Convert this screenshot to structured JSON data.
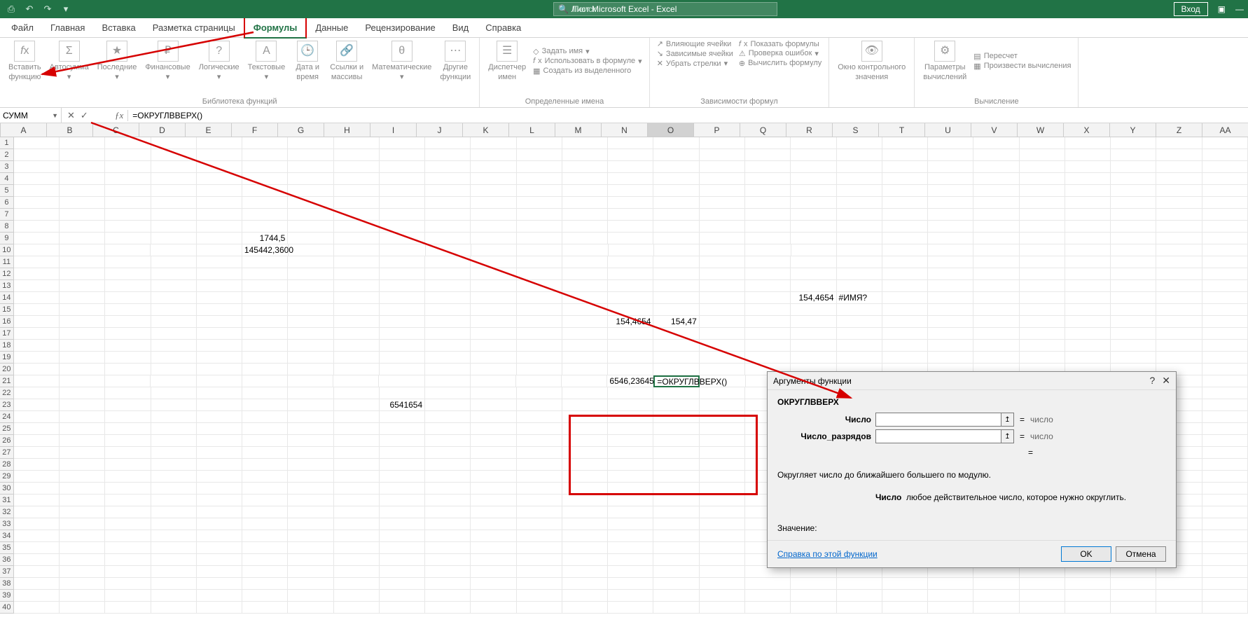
{
  "titlebar": {
    "title": "Лист Microsoft Excel  -  Excel",
    "search_placeholder": "Поиск",
    "login": "Вход"
  },
  "menu": {
    "items": [
      "Файл",
      "Главная",
      "Вставка",
      "Разметка страницы",
      "Формулы",
      "Данные",
      "Рецензирование",
      "Вид",
      "Справка"
    ],
    "active_index": 4
  },
  "ribbon": {
    "group1": {
      "insert_fn_l1": "Вставить",
      "insert_fn_l2": "функцию",
      "autosum_l1": "Автосумма",
      "recent_l1": "Последние",
      "financial_l1": "Финансовые",
      "logical_l1": "Логические",
      "text_l1": "Текстовые",
      "datetime_l1": "Дата и",
      "datetime_l2": "время",
      "lookup_l1": "Ссылки и",
      "lookup_l2": "массивы",
      "math_l1": "Математические",
      "other_l1": "Другие",
      "other_l2": "функции",
      "label": "Библиотека функций"
    },
    "group2": {
      "mgr_l1": "Диспетчер",
      "mgr_l2": "имен",
      "def_name": "Задать имя",
      "use_formula": "Использовать в формуле",
      "from_sel": "Создать из выделенного",
      "label": "Определенные имена"
    },
    "group3": {
      "trace_prec": "Влияющие ячейки",
      "trace_dep": "Зависимые ячейки",
      "remove_arr": "Убрать стрелки",
      "show_form": "Показать формулы",
      "check_err": "Проверка ошибок",
      "eval_form": "Вычислить формулу",
      "label": "Зависимости формул"
    },
    "group4": {
      "watch_l1": "Окно контрольного",
      "watch_l2": "значения"
    },
    "group5": {
      "opts_l1": "Параметры",
      "opts_l2": "вычислений",
      "recalc": "Пересчет",
      "calc_now": "Произвести вычисления",
      "label": "Вычисление"
    }
  },
  "formula_bar": {
    "namebox": "СУММ",
    "formula": "=ОКРУГЛВВЕРХ()"
  },
  "columns": [
    "A",
    "B",
    "C",
    "D",
    "E",
    "F",
    "G",
    "H",
    "I",
    "J",
    "K",
    "L",
    "M",
    "N",
    "O",
    "P",
    "Q",
    "R",
    "S",
    "T",
    "U",
    "V",
    "W",
    "X",
    "Y",
    "Z",
    "AA"
  ],
  "selected_col": "O",
  "cells": {
    "F9": "1744,5",
    "F10": "145442,3600",
    "N16": "154,4654",
    "O16": "154,47",
    "R14": "154,4654",
    "S14": "#ИМЯ?",
    "N21": "6546,23645",
    "O21": "=ОКРУГЛВВЕРХ()",
    "I23": "6541654"
  },
  "dialog": {
    "title": "Аргументы функции",
    "func_name": "ОКРУГЛВВЕРХ",
    "arg1_label": "Число",
    "arg1_result": "число",
    "arg2_label": "Число_разрядов",
    "arg2_result": "число",
    "eq_sym": "=",
    "desc1": "Округляет число до ближайшего большего по модулю.",
    "desc2_label": "Число",
    "desc2_text": "любое действительное число, которое нужно округлить.",
    "result_label": "Значение:",
    "help_link": "Справка по этой функции",
    "ok": "OK",
    "cancel": "Отмена",
    "help_sym": "?",
    "close_sym": "✕"
  }
}
